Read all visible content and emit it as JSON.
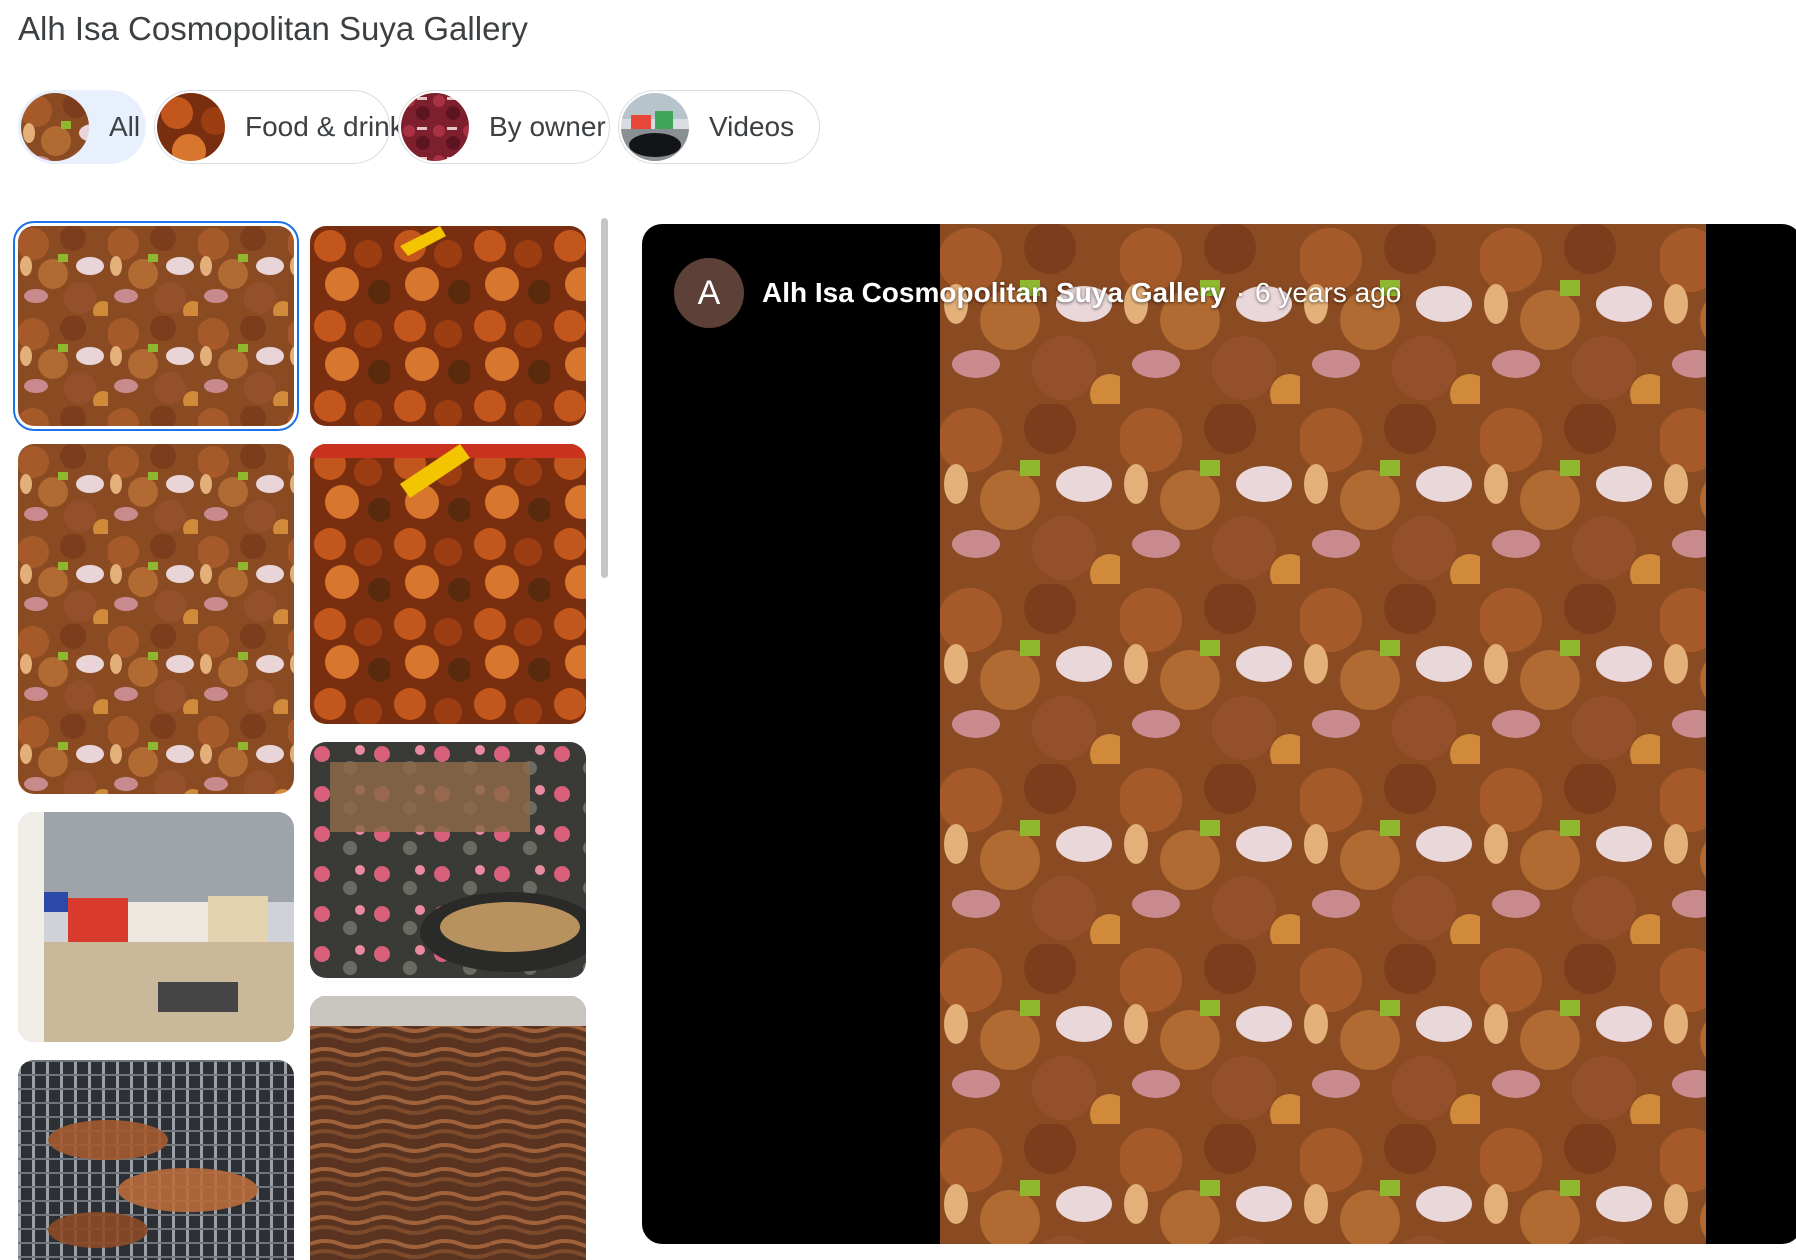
{
  "page": {
    "title": "Alh Isa Cosmopolitan Suya Gallery"
  },
  "filters": [
    {
      "label": "All",
      "selected": true,
      "thumb_icon": "suya-photo-icon"
    },
    {
      "label": "Food & drink",
      "selected": false,
      "thumb_icon": "suya-photo-icon"
    },
    {
      "label": "By owner",
      "selected": false,
      "thumb_icon": "raw-meat-photo-icon"
    },
    {
      "label": "Videos",
      "selected": false,
      "thumb_icon": "street-photo-icon"
    }
  ],
  "gallery": {
    "items": [
      {
        "subject": "suya with onions",
        "selected": true
      },
      {
        "subject": "grilled chicken with yellow spoon"
      },
      {
        "subject": "suya with onions and peppers"
      },
      {
        "subject": "grilled chicken with yellow spoon"
      },
      {
        "subject": "meat skewers over charcoal"
      },
      {
        "subject": "restaurant exterior"
      },
      {
        "subject": "kilishi dried meat"
      },
      {
        "subject": "meat on grill"
      }
    ]
  },
  "viewer": {
    "author": "Alh Isa Cosmopolitan Suya Gallery",
    "author_initial": "A",
    "separator": "·",
    "age": "6 years ago",
    "avatar_color": "#5d4037"
  },
  "colors": {
    "accent": "#1a73e8",
    "chip_selected_bg": "#e8f0fe",
    "viewer_bg": "#000000"
  }
}
